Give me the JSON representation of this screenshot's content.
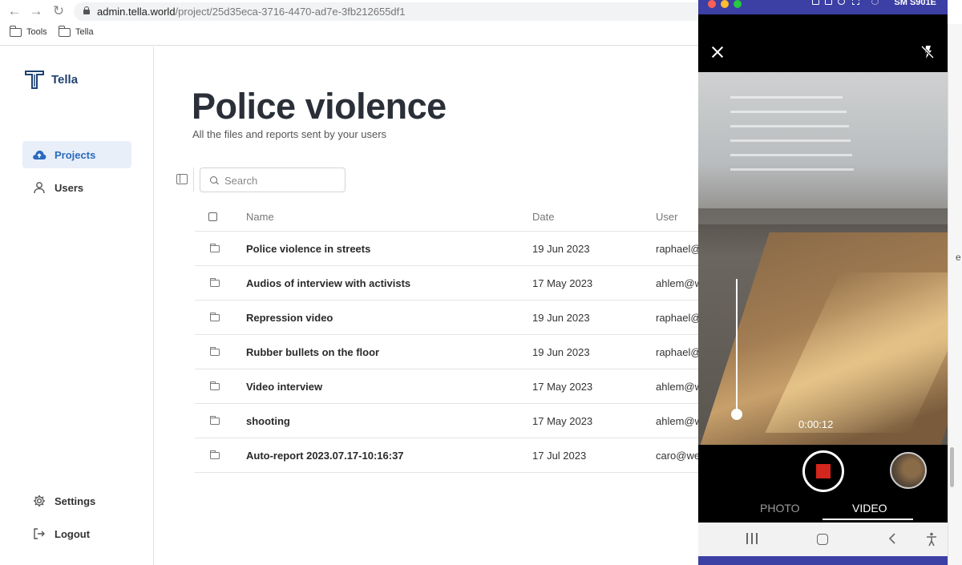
{
  "browser": {
    "url_host": "admin.tella.world",
    "url_path": "/project/25d35eca-3716-4470-ad7e-3fb212655df1",
    "bookmarks": [
      {
        "label": "Tools",
        "icon": "folder-icon"
      },
      {
        "label": "Tella",
        "icon": "folder-icon"
      }
    ]
  },
  "app": {
    "brand": "Tella",
    "accent_color": "#2a6bbf"
  },
  "sidebar": {
    "items": [
      {
        "label": "Projects",
        "icon": "cloud-upload-icon",
        "active": true
      },
      {
        "label": "Users",
        "icon": "user-icon",
        "active": false
      }
    ],
    "bottom_items": [
      {
        "label": "Settings",
        "icon": "gear-icon"
      },
      {
        "label": "Logout",
        "icon": "logout-icon"
      }
    ]
  },
  "main": {
    "title": "Police violence",
    "subtitle": "All the files and reports sent by your users",
    "search": {
      "placeholder": "Search",
      "value": ""
    }
  },
  "table": {
    "columns": [
      "Name",
      "Date",
      "User"
    ],
    "rows": [
      {
        "name": "Police violence in streets",
        "date": "19 Jun 2023",
        "user": "raphael@"
      },
      {
        "name": "Audios of interview with activists",
        "date": "17 May 2023",
        "user": "ahlem@w"
      },
      {
        "name": "Repression video",
        "date": "19 Jun 2023",
        "user": "raphael@"
      },
      {
        "name": "Rubber bullets on the floor",
        "date": "19 Jun 2023",
        "user": "raphael@"
      },
      {
        "name": "Video interview",
        "date": "17 May 2023",
        "user": "ahlem@w"
      },
      {
        "name": "shooting",
        "date": "17 May 2023",
        "user": "ahlem@w"
      },
      {
        "name": "Auto-report 2023.07.17-10:16:37",
        "date": "17 Jul 2023",
        "user": "caro@wea"
      }
    ]
  },
  "phone": {
    "device_name": "SM S901E",
    "timer": "0:00:12",
    "modes": [
      "PHOTO",
      "VIDEO"
    ],
    "active_mode": "VIDEO",
    "record_color": "#d3261c"
  },
  "background_window": {
    "glyph": "e"
  }
}
